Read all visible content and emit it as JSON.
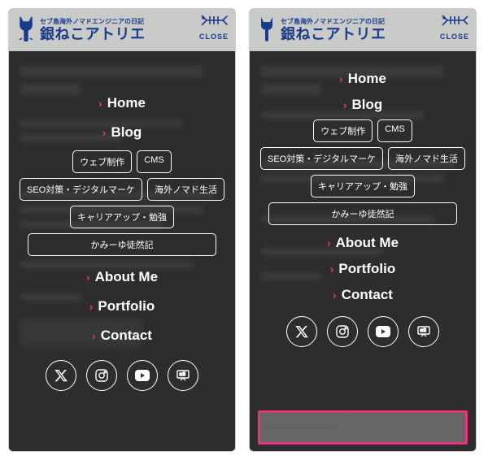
{
  "brand": {
    "tagline": "セブ島海外ノマドエンジニアの日記",
    "logo": "銀ねこアトリエ"
  },
  "close_label": "CLOSE",
  "nav": {
    "home": "Home",
    "blog": "Blog",
    "about": "About Me",
    "portfolio": "Portfolio",
    "contact": "Contact"
  },
  "tags": {
    "web": "ウェブ制作",
    "cms": "CMS",
    "seo": "SEO対策・デジタルマーケ",
    "nomad": "海外ノマド生活",
    "career": "キャリアアップ・勉強",
    "kamiyu": "かみーゆ徒然記"
  }
}
